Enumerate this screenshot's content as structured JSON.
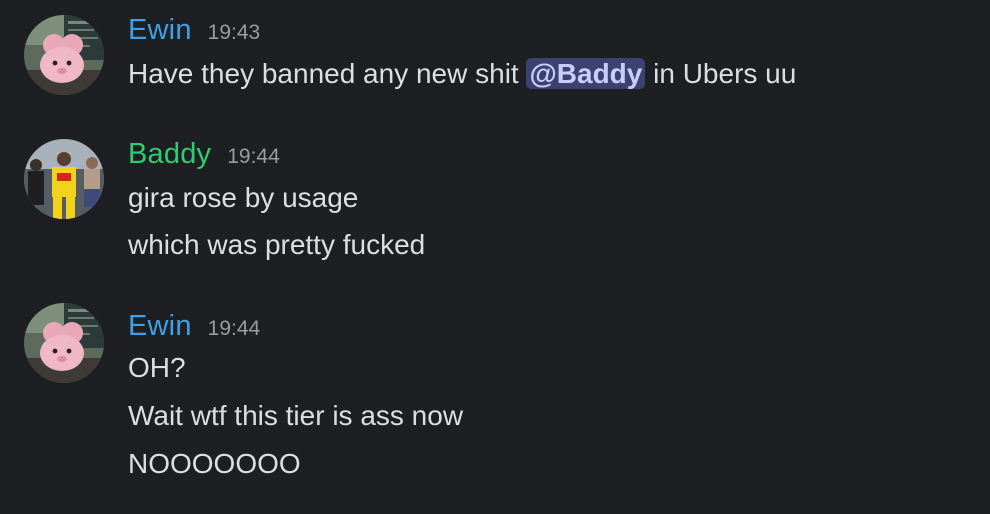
{
  "colors": {
    "background": "#1e1f22",
    "ewin_name": "#3ea0e5",
    "baddy_name": "#2fcc71",
    "text": "#dcdee1",
    "timestamp": "#9a9ca3",
    "mention_bg": "#3c4270",
    "mention_text": "#c9cdfb"
  },
  "messages": [
    {
      "author": "Ewin",
      "time": "19:43",
      "avatar_icon": "plush-toy-avatar",
      "lines": [
        {
          "before": "Have they banned any new shit ",
          "mention": "@Baddy",
          "after": " in Ubers uu"
        }
      ]
    },
    {
      "author": "Baddy",
      "time": "19:44",
      "avatar_icon": "group-photo-avatar",
      "lines": [
        "gira rose by usage",
        "which was pretty fucked"
      ]
    },
    {
      "author": "Ewin",
      "time": "19:44",
      "avatar_icon": "plush-toy-avatar",
      "lines": [
        "OH?",
        "Wait wtf this tier is ass now",
        "NOOOOOOO"
      ]
    }
  ]
}
